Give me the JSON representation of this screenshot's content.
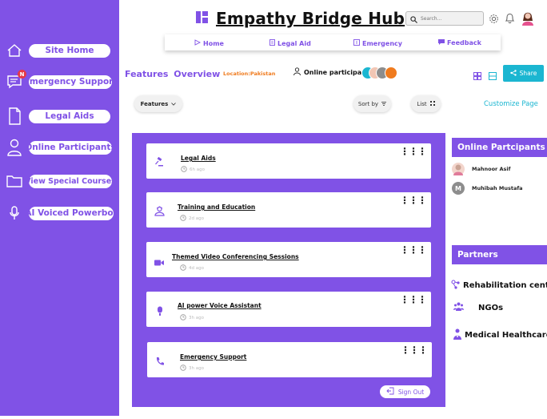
{
  "app": {
    "title": "Empathy Bridge Hub"
  },
  "sidebar": {
    "items": [
      {
        "label": "Site Home",
        "icon": "home-icon"
      },
      {
        "label": "Emergency Support",
        "icon": "emergency-chat-icon",
        "badge": "N"
      },
      {
        "label": "Legal Aids",
        "icon": "document-icon"
      },
      {
        "label": "Online Participants",
        "icon": "user-icon"
      },
      {
        "label": "View Special Courses",
        "icon": "folder-icon"
      },
      {
        "label": "AI Voiced Powerbot",
        "icon": "microphone-icon"
      }
    ]
  },
  "header": {
    "search_placeholder": "Search...",
    "icons": [
      "search-icon",
      "gear-icon",
      "bell-icon",
      "avatar"
    ]
  },
  "nav": {
    "items": [
      {
        "label": "Home",
        "icon": "home-nav-icon"
      },
      {
        "label": "Legal Aid",
        "icon": "legal-doc-icon"
      },
      {
        "label": "Emergency",
        "icon": "emergency-nav-icon"
      },
      {
        "label": "Feedback",
        "icon": "feedback-icon"
      }
    ]
  },
  "features": {
    "title": "Features  Overview",
    "location": "Location:Pakistan",
    "online_label": "Online participant",
    "share_label": "Share",
    "filter_label": "Features",
    "sort_label": "Sort by",
    "list_label": "List",
    "customize_label": "Customize Page"
  },
  "cards": [
    {
      "title": "Legal Aids",
      "time": "6h ago",
      "icon": "gavel-icon"
    },
    {
      "title": "Training and Education",
      "time": "2d ago",
      "icon": "graduation-icon"
    },
    {
      "title": "Themed Video Conferencing Sessions",
      "time": "4d ago",
      "icon": "video-icon"
    },
    {
      "title": "AI power Voice Assistant",
      "time": "3h ago",
      "icon": "mic-icon"
    },
    {
      "title": "Emergency Support",
      "time": "3h ago",
      "icon": "phone-icon"
    }
  ],
  "signout_label": "Sign Out",
  "online_participants": {
    "title": "Online Partcipants",
    "people": [
      {
        "name": "Mahnoor Asif",
        "avatar": ""
      },
      {
        "name": "Muhibah Mustafa",
        "avatar": "M"
      }
    ]
  },
  "partners": {
    "title": "Partners",
    "items": [
      {
        "label": "Rehabilitation center",
        "icon": "rehab-icon"
      },
      {
        "label": "NGOs",
        "icon": "group-icon"
      },
      {
        "label": "Medical Healthcares",
        "icon": "medical-icon"
      }
    ]
  },
  "colors": {
    "primary": "#8052e6",
    "accent": "#1bb6d1",
    "location": "#f07b1e",
    "badge": "#e63946"
  }
}
